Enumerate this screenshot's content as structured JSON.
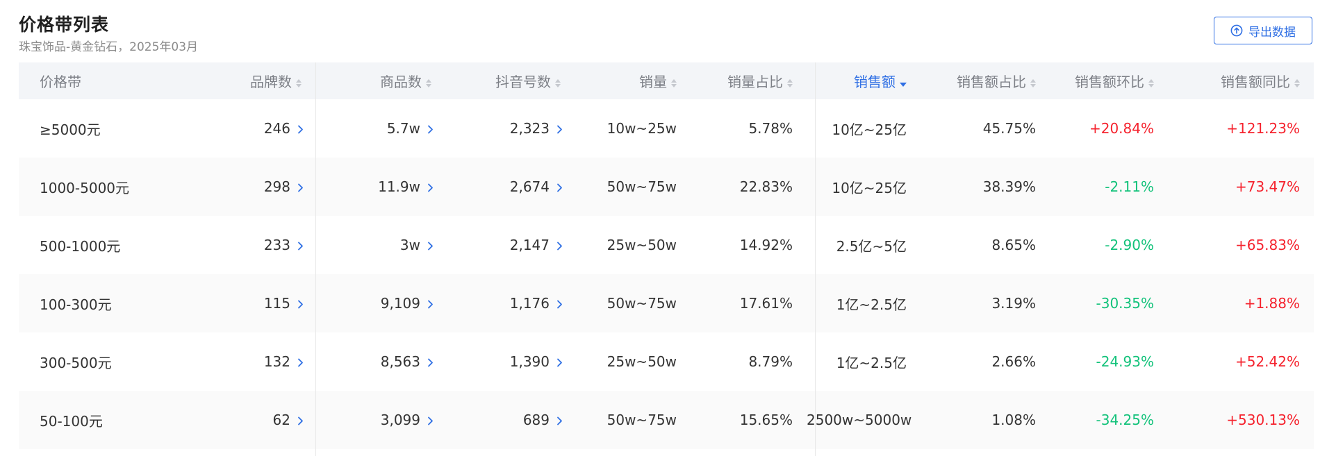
{
  "header": {
    "title": "价格带列表",
    "subtitle": "珠宝饰品-黄金钻石，2025年03月",
    "export_label": "导出数据"
  },
  "table": {
    "columns": [
      {
        "key": "price_band",
        "label": "价格带"
      },
      {
        "key": "brands",
        "label": "品牌数"
      },
      {
        "key": "products",
        "label": "商品数"
      },
      {
        "key": "douyin",
        "label": "抖音号数"
      },
      {
        "key": "sales_vol",
        "label": "销量"
      },
      {
        "key": "vol_share",
        "label": "销量占比"
      },
      {
        "key": "sales_amt",
        "label": "销售额"
      },
      {
        "key": "amt_share",
        "label": "销售额占比"
      },
      {
        "key": "amt_mom",
        "label": "销售额环比"
      },
      {
        "key": "amt_yoy",
        "label": "销售额同比"
      }
    ],
    "sorted_column": "销售额",
    "rows": [
      {
        "price_band": "≥5000元",
        "brands": "246",
        "products": "5.7w",
        "douyin": "2,323",
        "sales_vol": "10w~25w",
        "vol_share": "5.78%",
        "sales_amt": "10亿~25亿",
        "amt_share": "45.75%",
        "amt_mom": "+20.84%",
        "amt_yoy": "+121.23%"
      },
      {
        "price_band": "1000-5000元",
        "brands": "298",
        "products": "11.9w",
        "douyin": "2,674",
        "sales_vol": "50w~75w",
        "vol_share": "22.83%",
        "sales_amt": "10亿~25亿",
        "amt_share": "38.39%",
        "amt_mom": "-2.11%",
        "amt_yoy": "+73.47%"
      },
      {
        "price_band": "500-1000元",
        "brands": "233",
        "products": "3w",
        "douyin": "2,147",
        "sales_vol": "25w~50w",
        "vol_share": "14.92%",
        "sales_amt": "2.5亿~5亿",
        "amt_share": "8.65%",
        "amt_mom": "-2.90%",
        "amt_yoy": "+65.83%"
      },
      {
        "price_band": "100-300元",
        "brands": "115",
        "products": "9,109",
        "douyin": "1,176",
        "sales_vol": "50w~75w",
        "vol_share": "17.61%",
        "sales_amt": "1亿~2.5亿",
        "amt_share": "3.19%",
        "amt_mom": "-30.35%",
        "amt_yoy": "+1.88%"
      },
      {
        "price_band": "300-500元",
        "brands": "132",
        "products": "8,563",
        "douyin": "1,390",
        "sales_vol": "25w~50w",
        "vol_share": "8.79%",
        "sales_amt": "1亿~2.5亿",
        "amt_share": "2.66%",
        "amt_mom": "-24.93%",
        "amt_yoy": "+52.42%"
      },
      {
        "price_band": "50-100元",
        "brands": "62",
        "products": "3,099",
        "douyin": "689",
        "sales_vol": "50w~75w",
        "vol_share": "15.65%",
        "sales_amt": "2500w~5000w",
        "amt_share": "1.08%",
        "amt_mom": "-34.25%",
        "amt_yoy": "+530.13%"
      }
    ]
  },
  "colors": {
    "accent": "#2f6fe4",
    "positive": "#f5222d",
    "negative": "#12c27a",
    "header_bg": "#f3f5f8"
  },
  "icons": {
    "export": "upload-icon",
    "drill": "chevron-right-icon",
    "sort": "sort-caret-icon"
  }
}
